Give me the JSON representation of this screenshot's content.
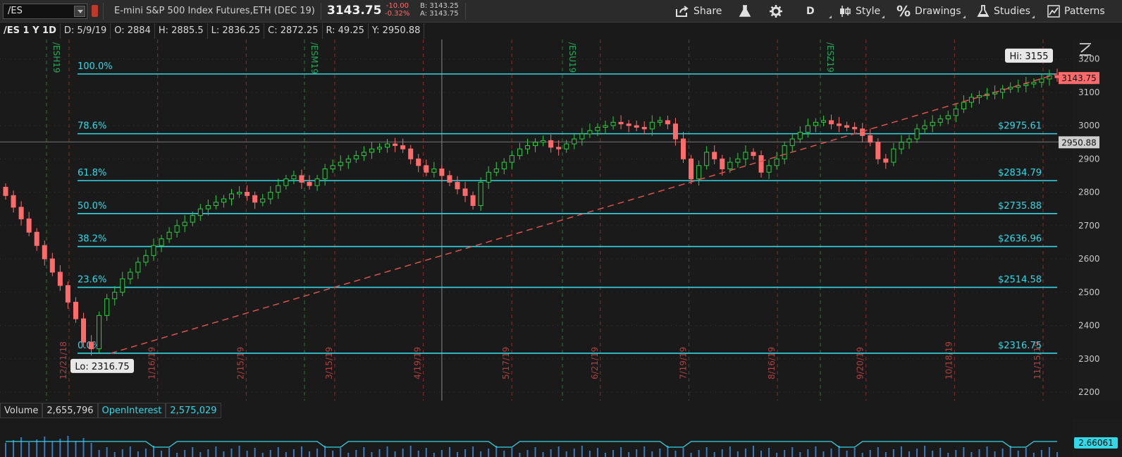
{
  "toolbar": {
    "symbol": "/ES",
    "description": "E-mini S&P 500 Index Futures,ETH (DEC 19)",
    "last_price": "3143.75",
    "net_change": "-10.00",
    "net_change_pct": "-0.32%",
    "bid": "B: 3143.25",
    "ask": "A: 3143.75",
    "share_label": "Share",
    "aggregation_label": "D",
    "style_label": "Style",
    "drawings_label": "Drawings",
    "studies_label": "Studies",
    "patterns_label": "Patterns"
  },
  "infobar": {
    "chart_id": "/ES 1 Y 1D",
    "date": "D: 5/9/19",
    "open": "O: 2884",
    "high": "H: 2885.5",
    "low": "L: 2836.25",
    "close": "C: 2872.25",
    "range": "R: 49.25",
    "y_value": "Y: 2950.88"
  },
  "colors": {
    "bull": "#2ecc40",
    "bear": "#ff6b6b",
    "fib": "#33d8e6",
    "trend": "#d9534f",
    "price_bubble": "#ff6b6b"
  },
  "chart_data": {
    "type": "candlestick",
    "ylim": [
      2200,
      3250
    ],
    "y_ticks": [
      2200,
      2300,
      2400,
      2500,
      2600,
      2700,
      2800,
      2900,
      3000,
      3100,
      3200
    ],
    "x_labels": [
      "12/21/18",
      "1/16/19",
      "2/15/19",
      "3/15/19",
      "4/19/19",
      "5/17/19",
      "6/21/19",
      "7/19/19",
      "8/16/19",
      "9/20/19",
      "10/18/19",
      "11/15/19"
    ],
    "contract_rolls": [
      "/ESH19",
      "/ESM19",
      "/ESU19",
      "/ESZ19"
    ],
    "fib_levels": [
      {
        "pct": "100.0%",
        "price": 3155,
        "label": ""
      },
      {
        "pct": "78.6%",
        "price": 2975.61,
        "label": "$2975.61"
      },
      {
        "pct": "61.8%",
        "price": 2834.79,
        "label": "$2834.79"
      },
      {
        "pct": "50.0%",
        "price": 2735.88,
        "label": "$2735.88"
      },
      {
        "pct": "38.2%",
        "price": 2636.96,
        "label": "$2636.96"
      },
      {
        "pct": "23.6%",
        "price": 2514.58,
        "label": "$2514.58"
      },
      {
        "pct": "0.0%",
        "price": 2316.75,
        "label": "$2316.75"
      }
    ],
    "hi_label": "Hi: 3155",
    "lo_label": "Lo: 2316.75",
    "current_price_label": "3143.75",
    "crosshair_price_label": "2950.88",
    "crosshair_price": 2950.88,
    "trendline": {
      "from_date_index": 0.1,
      "from_price": 2316.75,
      "to_date_index": 1.0,
      "to_price": 3155
    },
    "closes": [
      2790,
      2755,
      2720,
      2680,
      2640,
      2600,
      2560,
      2520,
      2470,
      2420,
      2350,
      2330,
      2430,
      2480,
      2500,
      2540,
      2560,
      2590,
      2610,
      2640,
      2660,
      2680,
      2700,
      2710,
      2730,
      2750,
      2760,
      2770,
      2780,
      2795,
      2800,
      2790,
      2770,
      2780,
      2800,
      2820,
      2840,
      2850,
      2830,
      2820,
      2840,
      2870,
      2880,
      2890,
      2900,
      2910,
      2920,
      2930,
      2935,
      2945,
      2940,
      2930,
      2900,
      2880,
      2860,
      2870,
      2850,
      2830,
      2810,
      2790,
      2760,
      2830,
      2860,
      2870,
      2890,
      2910,
      2930,
      2940,
      2950,
      2955,
      2935,
      2930,
      2945,
      2960,
      2975,
      2985,
      2995,
      3000,
      3010,
      3005,
      3000,
      2995,
      2990,
      3010,
      3015,
      3005,
      2960,
      2900,
      2840,
      2880,
      2920,
      2900,
      2870,
      2890,
      2900,
      2920,
      2910,
      2860,
      2880,
      2900,
      2940,
      2960,
      2980,
      3000,
      3010,
      3015,
      3005,
      3000,
      2995,
      2990,
      2970,
      2950,
      2900,
      2890,
      2930,
      2950,
      2960,
      2990,
      3000,
      3010,
      3020,
      3030,
      3050,
      3070,
      3085,
      3090,
      3095,
      3100,
      3110,
      3115,
      3120,
      3125,
      3130,
      3140,
      3150,
      3143.75
    ]
  },
  "volume": {
    "label": "Volume",
    "value": "2,655,796",
    "oi_label": "OpenInterest",
    "oi_value": "2,575,029",
    "right_value": "2.66061"
  }
}
